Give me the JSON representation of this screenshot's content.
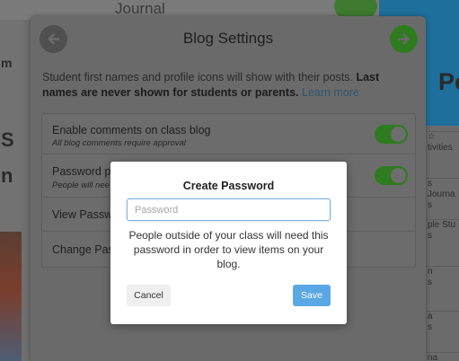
{
  "background": {
    "journal_text": "Journal",
    "right_heading": "Po",
    "left_letters": [
      "m",
      "S",
      "n"
    ],
    "right_rows": [
      "tivities",
      "s Journa",
      "s",
      "ple Stu",
      "s",
      "n",
      "s",
      "a",
      "s",
      "na"
    ]
  },
  "panel": {
    "title": "Blog Settings",
    "back_icon": "arrow-left-icon",
    "next_icon": "arrow-right-icon",
    "intro_text": "Student first names and profile icons will show with their posts. ",
    "intro_bold": "Last names are never shown for students or parents.",
    "intro_link": "Learn more",
    "settings": [
      {
        "title": "Enable comments on class blog",
        "subtitle": "All blog comments require approval",
        "toggle_on": true
      },
      {
        "title": "Password pr",
        "subtitle": "People will nee",
        "toggle_on": true
      },
      {
        "title": "View Passw"
      },
      {
        "title": "Change Pass"
      }
    ]
  },
  "modal": {
    "title": "Create Password",
    "input_placeholder": "Password",
    "input_value": "",
    "message": "People outside of your class will need this password in order to view items on your blog.",
    "cancel_label": "Cancel",
    "save_label": "Save"
  },
  "colors": {
    "accent_green": "#2f7b1f",
    "save_blue": "#5aa7e5",
    "input_border": "#7fb2dd"
  }
}
